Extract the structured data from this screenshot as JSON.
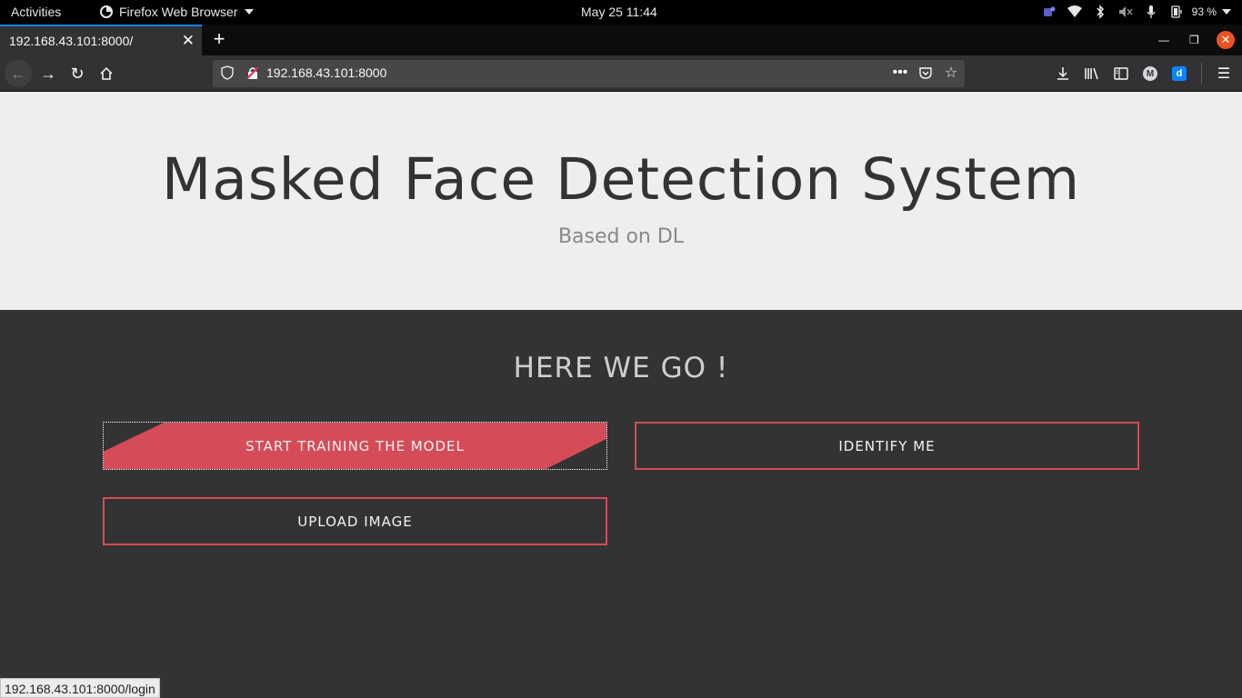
{
  "topbar": {
    "activities": "Activities",
    "app_menu": "Firefox Web Browser",
    "clock": "May 25  11:44",
    "battery": "93 %"
  },
  "browser": {
    "tab_title": "192.168.43.101:8000/",
    "url": "192.168.43.101:8000",
    "status_link": "192.168.43.101:8000/login"
  },
  "hero": {
    "title": "Masked Face Detection System",
    "subtitle": "Based on DL"
  },
  "main": {
    "heading": "HERE WE GO !",
    "buttons": {
      "train": "START TRAINING THE MODEL",
      "identify": "IDENTIFY ME",
      "upload": "UPLOAD IMAGE"
    }
  },
  "colors": {
    "accent": "#d44c58",
    "dark_bg": "#333333",
    "hero_bg": "#eeeeee"
  }
}
